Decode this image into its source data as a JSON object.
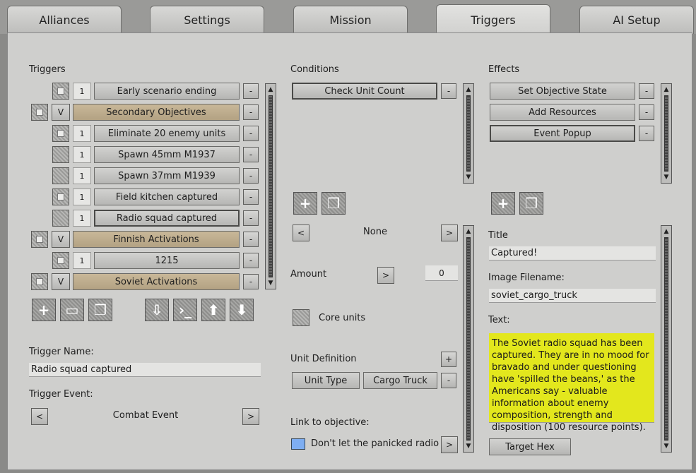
{
  "tabs": [
    {
      "label": "Alliances"
    },
    {
      "label": "Settings"
    },
    {
      "label": "Mission"
    },
    {
      "label": "Triggers"
    },
    {
      "label": "AI Setup"
    }
  ],
  "triggers": {
    "title": "Triggers",
    "rows": [
      {
        "num": "1",
        "label": "Early scenario ending"
      },
      {
        "flag": "V",
        "label": "Secondary Objectives"
      },
      {
        "num": "1",
        "label": "Eliminate 20 enemy units"
      },
      {
        "num": "1",
        "label": "Spawn 45mm M1937"
      },
      {
        "num": "1",
        "label": "Spawn 37mm M1939"
      },
      {
        "num": "1",
        "label": "Field kitchen captured"
      },
      {
        "num": "1",
        "label": "Radio squad captured"
      },
      {
        "flag": "V",
        "label": "Finnish Activations"
      },
      {
        "num": "1",
        "label": "1215"
      },
      {
        "flag": "V",
        "label": "Soviet Activations"
      }
    ],
    "remove_label": "-",
    "name_label": "Trigger Name:",
    "name_value": "Radio squad captured",
    "event_label": "Trigger Event:",
    "event_value": "Combat Event",
    "prev": "<",
    "next": ">"
  },
  "conditions": {
    "title": "Conditions",
    "items": [
      {
        "label": "Check Unit Count"
      }
    ],
    "remove_label": "-",
    "selector_value": "None",
    "prev": "<",
    "next": ">",
    "amount_label": "Amount",
    "amount_btn": ">",
    "amount_value": "0",
    "core_units_label": "Core units",
    "unit_def_label": "Unit Definition",
    "add_label": "+",
    "unit_type_label": "Unit Type",
    "unit_type_value": "Cargo Truck",
    "link_label": "Link to objective:",
    "link_value": "Don't let the panicked radio squad"
  },
  "effects": {
    "title": "Effects",
    "items": [
      {
        "label": "Set Objective State"
      },
      {
        "label": "Add Resources"
      },
      {
        "label": "Event Popup"
      }
    ],
    "remove_label": "-",
    "title_label": "Title",
    "title_value": "Captured!",
    "image_label": "Image Filename:",
    "image_value": "soviet_cargo_truck",
    "text_label": "Text:",
    "text_value": "The Soviet radio squad has been captured. They are in no mood for bravado and under questioning have 'spilled the beans,' as the Americans say - valuable information about enemy composition, strength and disposition (100 resource points).",
    "target_hex_label": "Target Hex"
  },
  "colors": {
    "accent_tan": "#c0ae8f",
    "note_yellow": "#e3e71d",
    "link_blue": "#7eaef2"
  }
}
